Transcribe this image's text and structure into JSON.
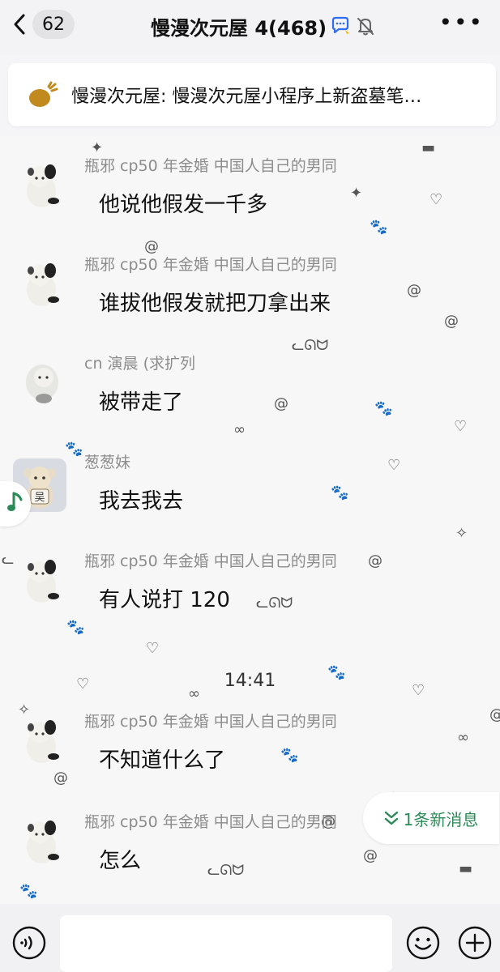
{
  "header": {
    "back_count": "62",
    "title": "慢漫次元屋 4(468)",
    "more_label": "•••"
  },
  "announcement": {
    "text": "慢漫次元屋: 慢漫次元屋小程序上新盗墓笔…"
  },
  "messages": [
    {
      "sender": "瓶邪 cp50 年金婚 中国人自己的男同",
      "text": "他说他假发一千多"
    },
    {
      "sender": "瓶邪 cp50 年金婚 中国人自己的男同",
      "text": "谁拔他假发就把刀拿出来"
    },
    {
      "sender": "cn 演晨 (求扩列",
      "text": "被带走了"
    },
    {
      "sender": "葱葱妹",
      "text": "我去我去"
    },
    {
      "sender": "瓶邪 cp50 年金婚 中国人自己的男同",
      "text": "有人说打 120"
    },
    {
      "sender": "瓶邪 cp50 年金婚 中国人自己的男同",
      "text": "不知道什么了"
    },
    {
      "sender": "瓶邪 cp50 年金婚 中国人自己的男同",
      "text": "怎么"
    }
  ],
  "timestamp": "14:41",
  "new_messages_label": "1条新消息",
  "icons": {
    "back": "chevron-left-icon",
    "chat_bubble": "chat-bubble-icon",
    "mute": "bell-off-icon",
    "announcement": "megaphone-icon",
    "music": "music-note-icon",
    "voice": "voice-icon",
    "emoji": "emoji-icon",
    "plus": "plus-icon",
    "double_down": "double-chevron-down-icon"
  },
  "colors": {
    "accent_green": "#2b8a57",
    "badge_bg": "#e3e3e6",
    "sender_gray": "#8c8c8c"
  }
}
